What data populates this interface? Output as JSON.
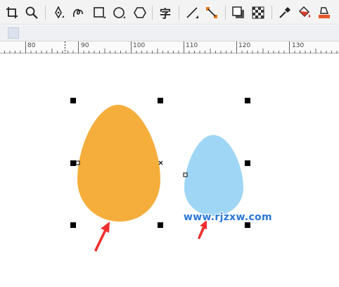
{
  "toolbar": {
    "tools": [
      {
        "name": "crop-tool",
        "icon": "crop-icon"
      },
      {
        "name": "zoom-tool",
        "icon": "magnifier-icon"
      },
      {
        "name": "pen-tool",
        "icon": "pen-nib-icon"
      },
      {
        "name": "freehand-tool",
        "icon": "curve-icon"
      },
      {
        "name": "rectangle-tool",
        "icon": "rectangle-icon"
      },
      {
        "name": "ellipse-tool",
        "icon": "ellipse-icon"
      },
      {
        "name": "polygon-tool",
        "icon": "hexagon-icon"
      },
      {
        "name": "text-tool",
        "icon": "text-char-icon",
        "glyph": "字"
      },
      {
        "name": "line-tool",
        "icon": "diagonal-line-icon"
      },
      {
        "name": "connector-tool",
        "icon": "connector-icon"
      },
      {
        "name": "shadow-tool",
        "icon": "drop-shadow-icon"
      },
      {
        "name": "transparency-tool",
        "icon": "checkerboard-icon"
      },
      {
        "name": "eyedropper-tool",
        "icon": "eyedropper-icon"
      },
      {
        "name": "fill-tool",
        "icon": "paint-bucket-icon"
      },
      {
        "name": "smart-fill-tool",
        "icon": "smart-fill-icon"
      }
    ]
  },
  "ruler": {
    "labels": [
      "80",
      "90",
      "100",
      "110",
      "120",
      "130"
    ]
  },
  "canvas": {
    "shapes": [
      {
        "name": "orange-egg-shape",
        "color": "#f5ae3c",
        "selected": true
      },
      {
        "name": "blue-egg-shape",
        "color": "#9fd6f5",
        "selected": false
      }
    ],
    "arrow_color": "#f02e2e",
    "watermark": "www.rjzxw.com"
  }
}
